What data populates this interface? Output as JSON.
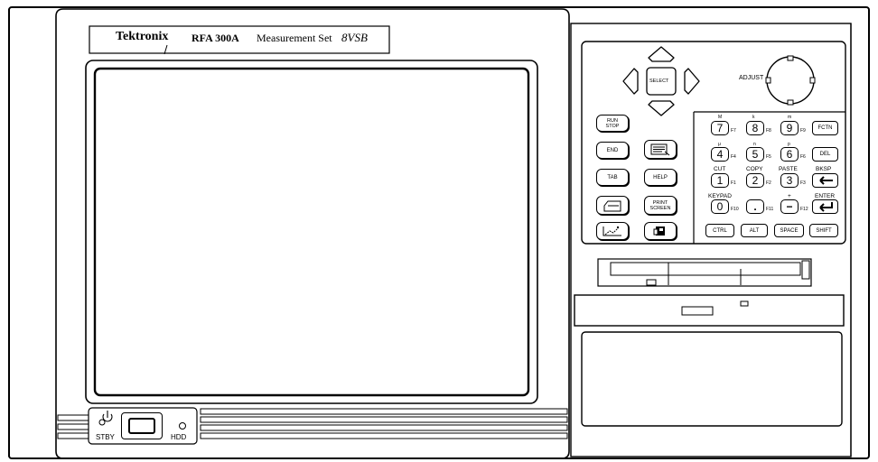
{
  "brand": {
    "maker": "Tektronix",
    "model": "RFA 300A",
    "product": "Measurement Set",
    "mode": "8VSB"
  },
  "front_panel": {
    "standby_label": "STBY",
    "hdd_label": "HDD",
    "adjust_label": "ADJUST",
    "select_label": "SELECT"
  },
  "left_keys": [
    {
      "id": "run-stop",
      "label": "RUN\nSTOP"
    },
    {
      "id": "end",
      "label": "END"
    },
    {
      "id": "menu-icon",
      "label": ""
    },
    {
      "id": "tab",
      "label": "TAB"
    },
    {
      "id": "help",
      "label": "HELP"
    },
    {
      "id": "printer-icon",
      "label": ""
    },
    {
      "id": "print-screen",
      "label": "PRINT\nSCREEN"
    },
    {
      "id": "graph-icon",
      "label": ""
    },
    {
      "id": "window-icon",
      "label": ""
    }
  ],
  "keypad": {
    "row1": [
      {
        "top": "M",
        "key": "7",
        "fn": "F7"
      },
      {
        "top": "k",
        "key": "8",
        "fn": "F8"
      },
      {
        "top": "m",
        "key": "9",
        "fn": "F9"
      }
    ],
    "row2": [
      {
        "top": "μ",
        "key": "4",
        "fn": "F4"
      },
      {
        "top": "n",
        "key": "5",
        "fn": "F5"
      },
      {
        "top": "p",
        "key": "6",
        "fn": "F6"
      }
    ],
    "row3": [
      {
        "top": "CUT",
        "key": "1",
        "fn": "F1"
      },
      {
        "top": "COPY",
        "key": "2",
        "fn": "F2"
      },
      {
        "top": "PASTE",
        "key": "3",
        "fn": "F3"
      }
    ],
    "row4": [
      {
        "top": "KEYPAD",
        "key": "0",
        "fn": "F10"
      },
      {
        "top": "",
        "key": ".",
        "fn": "F11"
      },
      {
        "top": "+",
        "key": "−",
        "fn": "F12"
      }
    ],
    "right_col": {
      "fctn": "FCTN",
      "del": "DEL",
      "bksp": "BKSP",
      "enter": "ENTER"
    },
    "bottom_row": [
      "CTRL",
      "ALT",
      "SPACE",
      "SHIFT"
    ]
  }
}
